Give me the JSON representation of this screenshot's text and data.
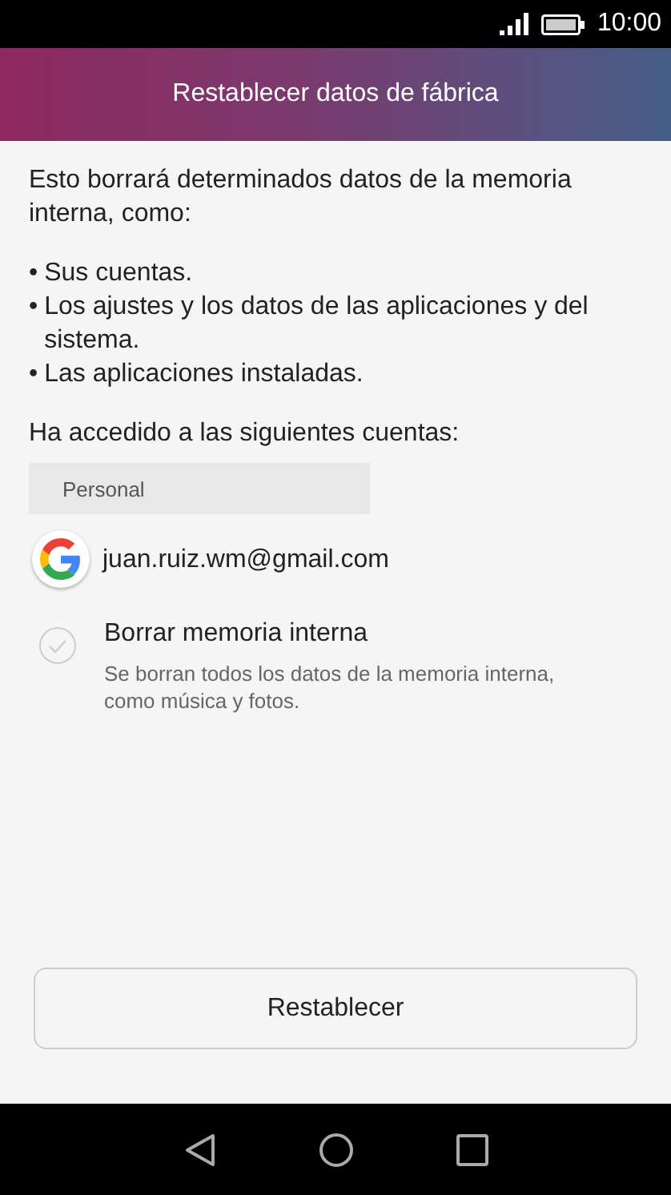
{
  "status_bar": {
    "time": "10:00"
  },
  "header": {
    "title": "Restablecer datos de fábrica"
  },
  "intro": "Esto borrará determinados datos de la memoria interna, como:",
  "bullets": [
    {
      "marker": "•",
      "text": "Sus cuentas."
    },
    {
      "marker": "•",
      "text": "Los ajustes y los datos de las aplicaciones y del sistema."
    },
    {
      "marker": "•",
      "text": "Las aplicaciones instaladas."
    }
  ],
  "accounts_heading": "Ha accedido a las siguientes cuentas:",
  "accounts_section": {
    "title": "Personal",
    "accounts": [
      {
        "email": "juan.ruiz.wm@gmail.com"
      }
    ]
  },
  "option": {
    "title": "Borrar memoria interna",
    "description": "Se borran todos los datos de la memoria interna, como música y fotos.",
    "checked": false
  },
  "button": "Restablecer"
}
